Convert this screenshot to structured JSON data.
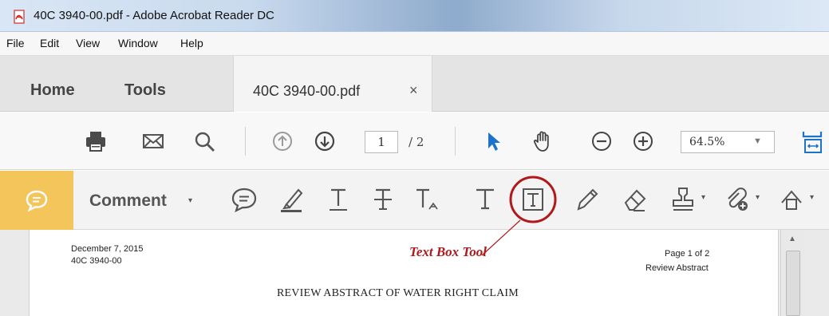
{
  "window": {
    "title": "40C 3940-00.pdf - Adobe Acrobat Reader DC"
  },
  "menu": {
    "items": [
      "File",
      "Edit",
      "View",
      "Window",
      "Help"
    ]
  },
  "tabs": {
    "home": "Home",
    "tools": "Tools",
    "document": "40C 3940-00.pdf",
    "close": "×"
  },
  "toolbar": {
    "page_number": "1",
    "page_total": "/ 2",
    "zoom": "64.5%",
    "zoom_caret": "▼",
    "icons": [
      "print-icon",
      "email-icon",
      "search-icon",
      "previous-page-icon",
      "next-page-icon",
      "select-arrow-icon",
      "hand-icon",
      "zoom-out-icon",
      "zoom-in-icon",
      "fit-page-icon"
    ]
  },
  "comment_toolbar": {
    "label": "Comment",
    "caret": "▾",
    "tools": [
      "sticky-note-icon",
      "highlight-icon",
      "underline-text-icon",
      "strikethrough-text-icon",
      "insert-text-icon",
      "add-text-icon",
      "text-box-icon",
      "pencil-icon",
      "eraser-icon",
      "stamp-icon",
      "attach-file-icon",
      "draw-shapes-icon"
    ]
  },
  "document": {
    "date": "December 7, 2015",
    "case_id": "40C  3940-00",
    "page_info": "Page 1 of 2",
    "doc_type": "Review Abstract",
    "heading": "REVIEW ABSTRACT OF WATER RIGHT CLAIM",
    "annotation": "Text Box Tool"
  },
  "colors": {
    "comment_accent": "#f4c55a",
    "annotation_red": "#b0181b",
    "select_arrow_blue": "#1e73c9"
  }
}
